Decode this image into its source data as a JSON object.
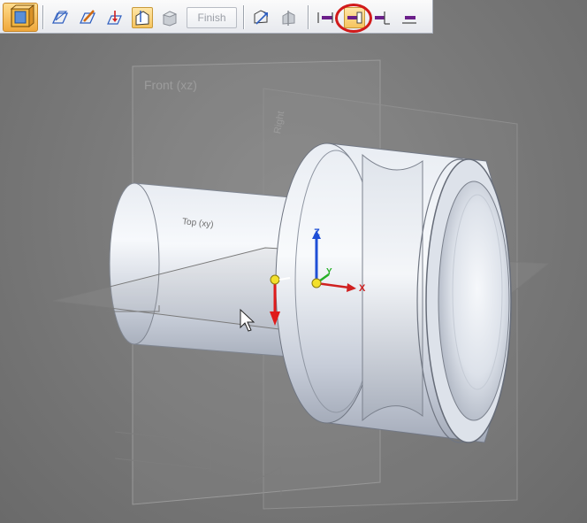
{
  "toolbar": {
    "finish_label": "Finish",
    "accent_active": "#f6c45e",
    "highlight_color": "#d11a1a"
  },
  "viewport": {
    "plane_front_label": "Front (xz)",
    "plane_right_label": "Right",
    "plane_top_label": "Top (xy)",
    "axis_z_label": "Z",
    "axis_x_label": "X",
    "axis_y_label": "Y"
  }
}
